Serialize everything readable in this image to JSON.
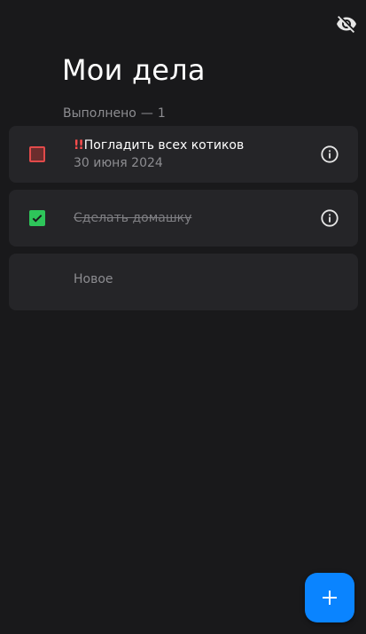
{
  "header": {
    "title": "Мои дела",
    "done_label": "Выполнено",
    "done_separator": "—",
    "done_count": "1",
    "visibility_icon": "eye-off-icon"
  },
  "tasks": [
    {
      "priority_mark": "!!",
      "title": "Погладить всех котиков",
      "date": "30 июня 2024",
      "done": false,
      "priority": "high"
    },
    {
      "priority_mark": "",
      "title": "Сделать домашку",
      "date": "",
      "done": true,
      "priority": "normal"
    }
  ],
  "new_item": {
    "label": "Новое"
  },
  "fab": {
    "icon": "plus-icon"
  },
  "colors": {
    "background": "#19191b",
    "card": "#252528",
    "accent": "#0a84ff",
    "done_green": "#2ec55a",
    "high_priority_red": "#e24a4a"
  }
}
